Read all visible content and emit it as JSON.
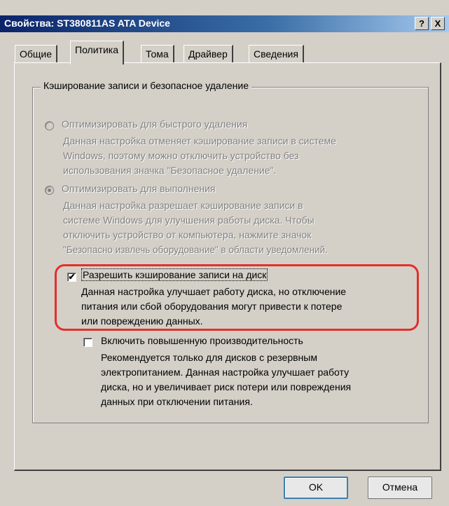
{
  "window": {
    "title": "Свойства: ST380811AS ATA Device",
    "help_label": "?",
    "close_label": "X"
  },
  "tabs": [
    {
      "label": "Общие",
      "active": false
    },
    {
      "label": "Политика",
      "active": true
    },
    {
      "label": "Тома",
      "active": false
    },
    {
      "label": "Драйвер",
      "active": false
    },
    {
      "label": "Сведения",
      "active": false
    }
  ],
  "group": {
    "label": "Кэширование записи и безопасное удаление",
    "option_quick": {
      "label": "Оптимизировать для быстрого удаления",
      "selected": false,
      "enabled": false,
      "description_lines": [
        "Данная настройка отменяет кэширование записи в системе",
        "Windows, поэтому можно отключить устройство без",
        "использования значка \"Безопасное удаление\"."
      ]
    },
    "option_perf": {
      "label": "Оптимизировать для выполнения",
      "selected": true,
      "enabled": false,
      "description_lines": [
        "Данная настройка разрешает кэширование записи в",
        "системе Windows для улучшения работы диска. Чтобы",
        "отключить устройство от компьютера, нажмите значок",
        "\"Безопасно извлечь оборудование\" в области уведомлений."
      ]
    },
    "write_cache": {
      "label": "Разрешить кэширование записи на диск",
      "checked": true,
      "description_lines": [
        "Данная настройка улучшает работу диска, но отключение",
        "питания или сбой оборудования могут привести к потере",
        "или повреждению данных."
      ]
    },
    "advanced_perf": {
      "label": "Включить повышенную производительность",
      "checked": false,
      "description_lines": [
        "Рекомендуется только для дисков с резервным",
        "электропитанием. Данная настройка улучшает работу",
        "диска, но и увеличивает риск потери или повреждения",
        "данных при отключении питания."
      ]
    }
  },
  "buttons": {
    "ok": "OK",
    "cancel": "Отмена"
  },
  "colors": {
    "highlight_border": "#e2302c",
    "titlebar_start": "#0a246a",
    "titlebar_end": "#a6caf0"
  }
}
